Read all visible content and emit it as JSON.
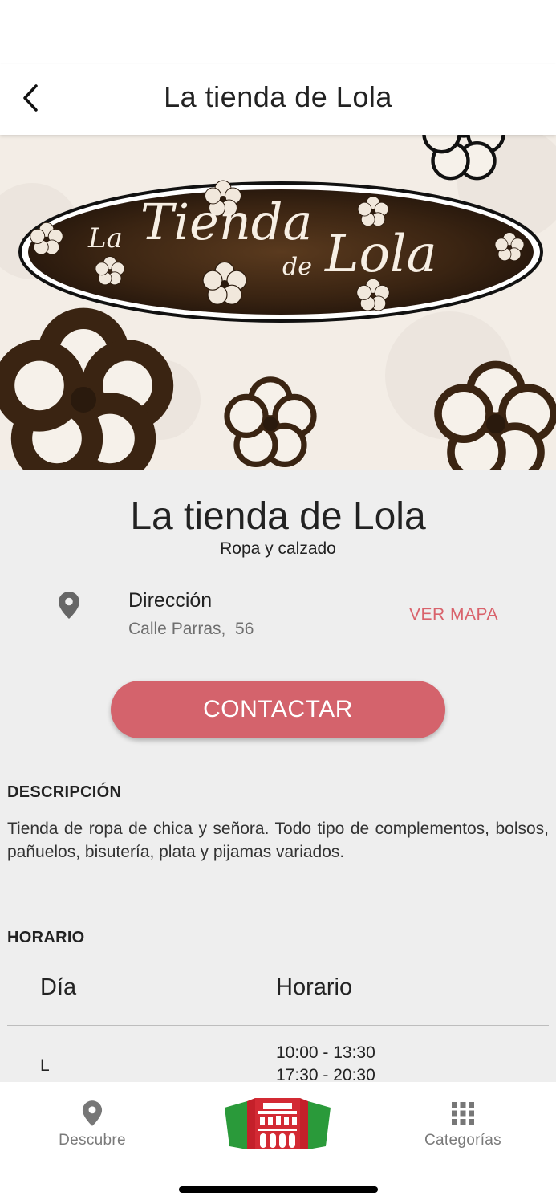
{
  "nav": {
    "title": "La tienda de Lola"
  },
  "hero": {
    "logo_text": "La Tienda de Lola"
  },
  "store": {
    "name": "La tienda de Lola",
    "category": "Ropa y calzado"
  },
  "address": {
    "label": "Dirección",
    "value": "Calle Parras,  56",
    "map_link": "VER MAPA"
  },
  "contact_button": "CONTACTAR",
  "description": {
    "title": "DESCRIPCIÓN",
    "text": "Tienda de ropa de chica y señora. Todo tipo de complementos, bolsos, pañuelos, bisutería, plata y pijamas variados."
  },
  "hours": {
    "title": "HORARIO",
    "columns": {
      "day": "Día",
      "hours": "Horario"
    },
    "rows": [
      {
        "day": "L",
        "slot1": "10:00 - 13:30",
        "slot2": "17:30 - 20:30"
      }
    ]
  },
  "tabbar": {
    "descubre": "Descubre",
    "categorias": "Categorías"
  },
  "colors": {
    "accent": "#d4636c",
    "link": "#d9626b",
    "background": "#eeeeee"
  }
}
